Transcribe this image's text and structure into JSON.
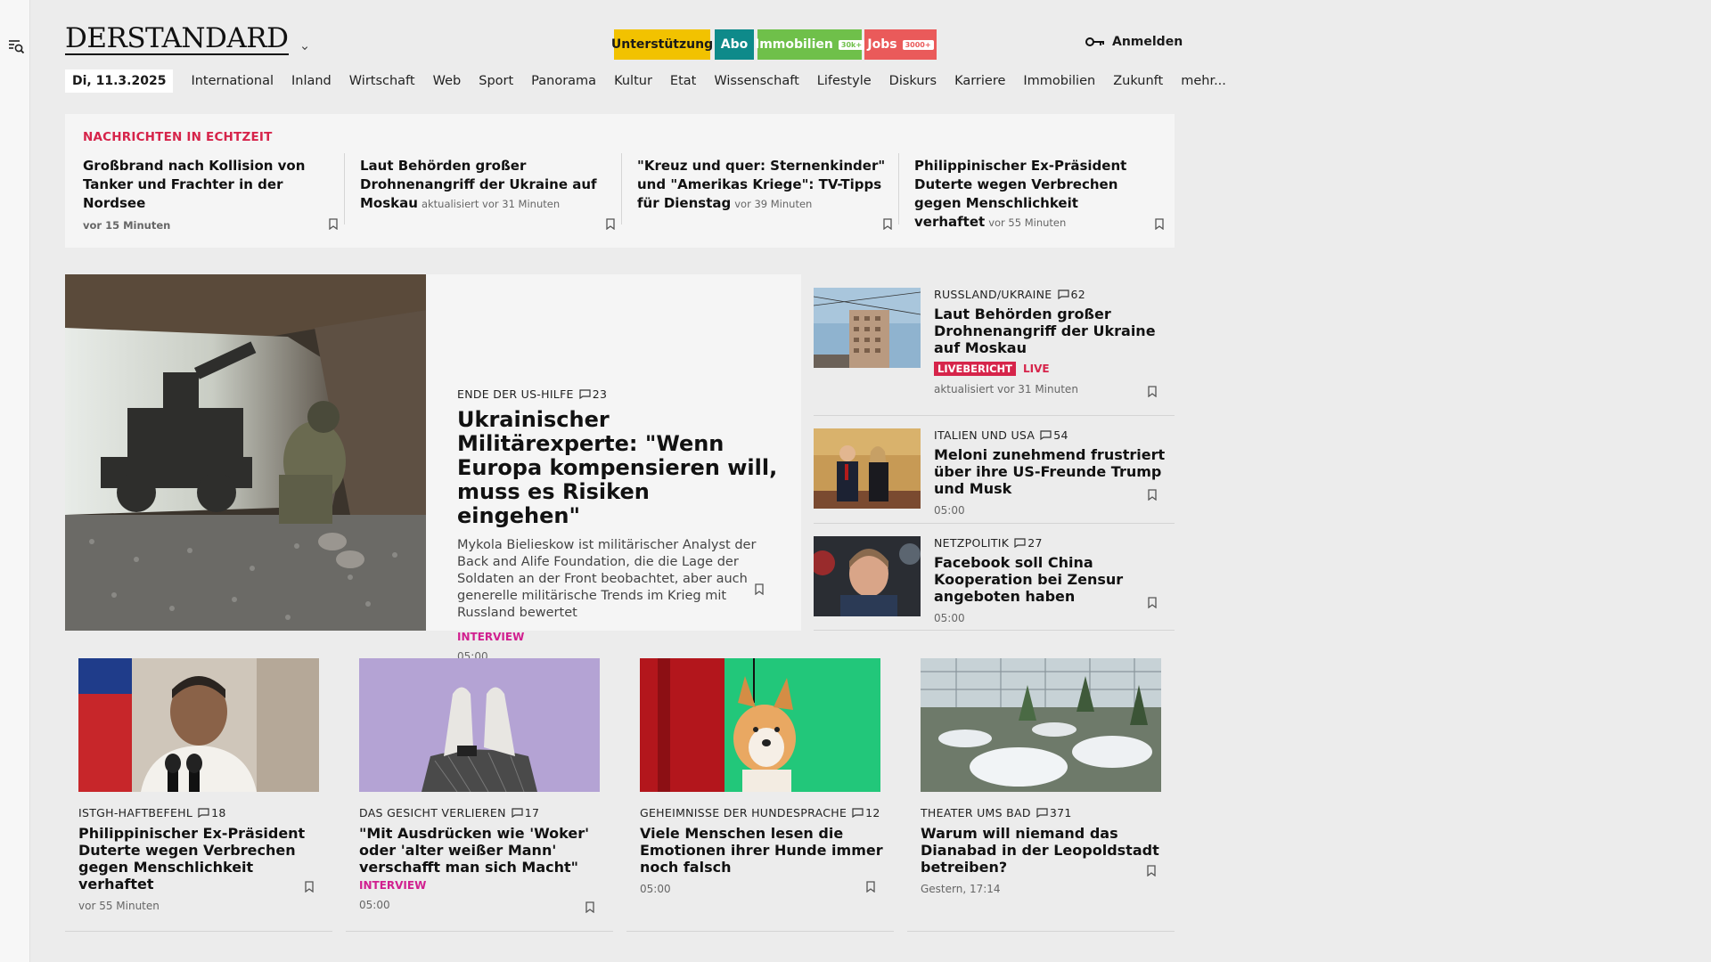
{
  "brand": {
    "logo_text": "DERSTANDARD"
  },
  "promos": {
    "unterstuetzung": "Unterstützung",
    "abo": "Abo",
    "immobilien": "Immobilien",
    "immobilien_badge": "30k+",
    "jobs": "Jobs",
    "jobs_badge": "3000+"
  },
  "login_label": "Anmelden",
  "nav": {
    "date": "Di, 11.3.2025",
    "items": [
      "International",
      "Inland",
      "Wirtschaft",
      "Web",
      "Sport",
      "Panorama",
      "Kultur",
      "Etat",
      "Wissenschaft",
      "Lifestyle",
      "Diskurs",
      "Karriere",
      "Immobilien",
      "Zukunft",
      "mehr..."
    ]
  },
  "ticker": {
    "label": "NACHRICHTEN IN ECHTZEIT",
    "items": [
      {
        "title": "Großbrand nach Kollision von Tanker und Frachter in der Nordsee",
        "meta": "vor 15 Minuten"
      },
      {
        "title": "Laut Behörden großer Drohnenangriff der Ukraine auf Moskau",
        "meta": "aktualisiert vor 31 Minuten"
      },
      {
        "title": "\"Kreuz und quer: Sternenkinder\" und \"Amerikas Kriege\": TV-Tipps für Dienstag",
        "meta": "vor 39 Minuten"
      },
      {
        "title": "Philippinischer Ex-Präsident Duterte wegen Verbrechen gegen Menschlichkeit verhaftet",
        "meta": "vor 55 Minuten"
      }
    ]
  },
  "hero": {
    "kicker": "ENDE DER US-HILFE",
    "comments": "23",
    "title": "Ukrainischer Militärexperte: \"Wenn Europa kompensieren will, muss es Risiken eingehen\"",
    "description": "Mykola Bielieskow ist militärischer Analyst der Back and Alife Foundation, die die Lage der Soldaten an der Front beobachtet, aber auch generelle militärische Trends im Krieg mit Russland bewertet",
    "tag": "INTERVIEW",
    "time": "05:00"
  },
  "side": [
    {
      "kicker": "RUSSLAND/UKRAINE",
      "comments": "62",
      "title": "Laut Behörden großer Drohnenangriff der Ukraine auf Moskau",
      "badge": "LIVEBERICHT",
      "live": "LIVE",
      "time": "aktualisiert vor 31 Minuten"
    },
    {
      "kicker": "ITALIEN UND USA",
      "comments": "54",
      "title": "Meloni zunehmend frustriert über ihre US-Freunde Trump und Musk",
      "time": "05:00"
    },
    {
      "kicker": "NETZPOLITIK",
      "comments": "27",
      "title": "Facebook soll China Kooperation bei Zensur angeboten haben",
      "time": "05:00"
    }
  ],
  "cards": [
    {
      "kicker": "ISTGH-HAFTBEFEHL",
      "comments": "18",
      "title": "Philippinischer Ex-Präsident Duterte wegen Verbrechen gegen Menschlichkeit verhaftet",
      "time": "vor 55 Minuten"
    },
    {
      "kicker": "DAS GESICHT VERLIEREN",
      "comments": "17",
      "title": "\"Mit Ausdrücken wie 'Woker' oder 'alter weißer Mann' verschafft man sich Macht\"",
      "tag": "INTERVIEW",
      "time": "05:00"
    },
    {
      "kicker": "GEHEIMNISSE DER HUNDESPRACHE",
      "comments": "12",
      "title": "Viele Menschen lesen die Emotionen ihrer Hunde immer noch falsch",
      "time": "05:00"
    },
    {
      "kicker": "THEATER UMS BAD",
      "comments": "371",
      "title": "Warum will niemand das Dianabad in der Leopoldstadt betreiben?",
      "time": "Gestern, 17:14"
    }
  ],
  "colors": {
    "accent_red": "#d6244a",
    "interview_magenta": "#d11f8f",
    "background": "#ececec"
  },
  "icons": [
    "menu-search-icon",
    "chevron-down-icon",
    "key-icon",
    "comment-icon",
    "bookmark-icon"
  ]
}
